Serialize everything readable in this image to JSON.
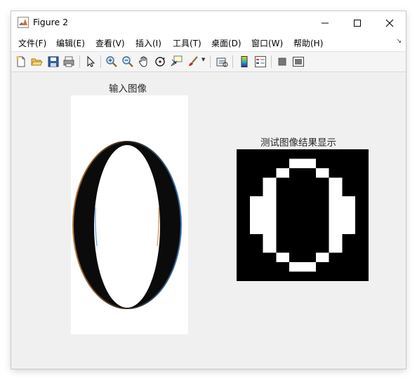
{
  "window": {
    "title": "Figure 2",
    "icon": "matlab-icon"
  },
  "window_controls": [
    "minimize-icon",
    "maximize-icon",
    "close-icon"
  ],
  "menu": [
    {
      "label": "文件(F)"
    },
    {
      "label": "编辑(E)"
    },
    {
      "label": "查看(V)"
    },
    {
      "label": "插入(I)"
    },
    {
      "label": "工具(T)"
    },
    {
      "label": "桌面(D)"
    },
    {
      "label": "窗口(W)"
    },
    {
      "label": "帮助(H)"
    }
  ],
  "toolbar": {
    "buttons": [
      "new-figure-icon",
      "open-file-icon",
      "save-icon",
      "print-icon",
      "edit-plot-icon",
      "zoom-in-icon",
      "zoom-out-icon",
      "pan-icon",
      "rotate-3d-icon",
      "data-cursor-icon",
      "brush-icon",
      "link-plot-icon",
      "colorbar-icon",
      "legend-icon",
      "hide-plot-tools-icon",
      "show-plot-tools-icon"
    ]
  },
  "axes": [
    {
      "title": "输入图像"
    },
    {
      "title": "测试图像结果显示"
    }
  ],
  "binary_image": {
    "rows": [
      "0000000000",
      "0000110000",
      "0001001000",
      "0010000100",
      "0010000100",
      "0110000110",
      "0110000110",
      "0110000110",
      "0110000110",
      "0010000100",
      "0010000100",
      "0001001000",
      "0000110000",
      "0000000000"
    ]
  }
}
